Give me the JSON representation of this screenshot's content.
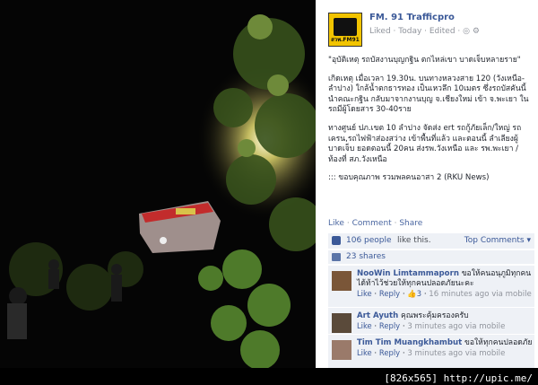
{
  "page": {
    "name": "FM. 91 Trafficpro",
    "logo_text": "สวพ.FM91",
    "meta": {
      "liked": "Liked",
      "today": "Today",
      "edited": "Edited"
    },
    "post_paragraphs": [
      "\"อุบัติเหตุ รถบัสงานบุญกฐิน ตกไหล่เขา บาดเจ็บหลายราย\"",
      "เกิดเหตุ เมื่อเวลา 19.30น. บนทางหลวงสาย 120 (วังเหนือ-ลำปาง) ใกล้น้ำตกธารทอง เป็นเหวลึก 10เมตร ซึ่งรถบัสคันนี้นำคณะกฐิน กลับมาจากงานบุญ จ.เชียงใหม่ เข้า จ.พะเยา ในรถมีผู้โดยสาร 30-40ราย",
      "ทางศูนย์ ปภ.เขต 10 ลำปาง จัดส่ง ert รถกู้ภัยเล็ก/ใหญ่ รถเครน,รถไฟฟ้าส่องสว่าง เข้าพื้นที่แล้ว และตอนนี้ ลำเลียงผู้บาดเจ็บ ยอดตอนนี้ 20คน ส่งรพ.วังเหนือ และ รพ.พะเยา / ท้องที่ สภ.วังเหนือ",
      "::: ขอบคุณภาพ รวมพลคนอาสา 2 (RKU News)"
    ],
    "actions": {
      "like": "Like",
      "comment": "Comment",
      "share": "Share"
    },
    "likes": {
      "count": "106 people",
      "rest": "like this.",
      "top_comments": "Top Comments"
    },
    "shares": "23 shares",
    "comments": [
      {
        "name": "NooWin Limtammaporn",
        "text": "ขอให้คนอนุภูมิทุกคนได้ท้าไว้ช่วยให้ทุกคนปลอดภัยนะคะ",
        "like": "Like",
        "reply": "Reply",
        "likes": "3",
        "time": "16 minutes ago via mobile"
      },
      {
        "name": "Art Ayuth",
        "text": "คุณพระคุ้มครองครับ",
        "like": "Like",
        "reply": "Reply",
        "time": "3 minutes ago via mobile"
      },
      {
        "name": "Tim Tim Muangkhambut",
        "text": "ขอให้ทุกคนปลอดภัย",
        "like": "Like",
        "reply": "Reply",
        "time": "3 minutes ago via mobile"
      }
    ]
  },
  "watermark": "[826x565] http://upic.me/"
}
